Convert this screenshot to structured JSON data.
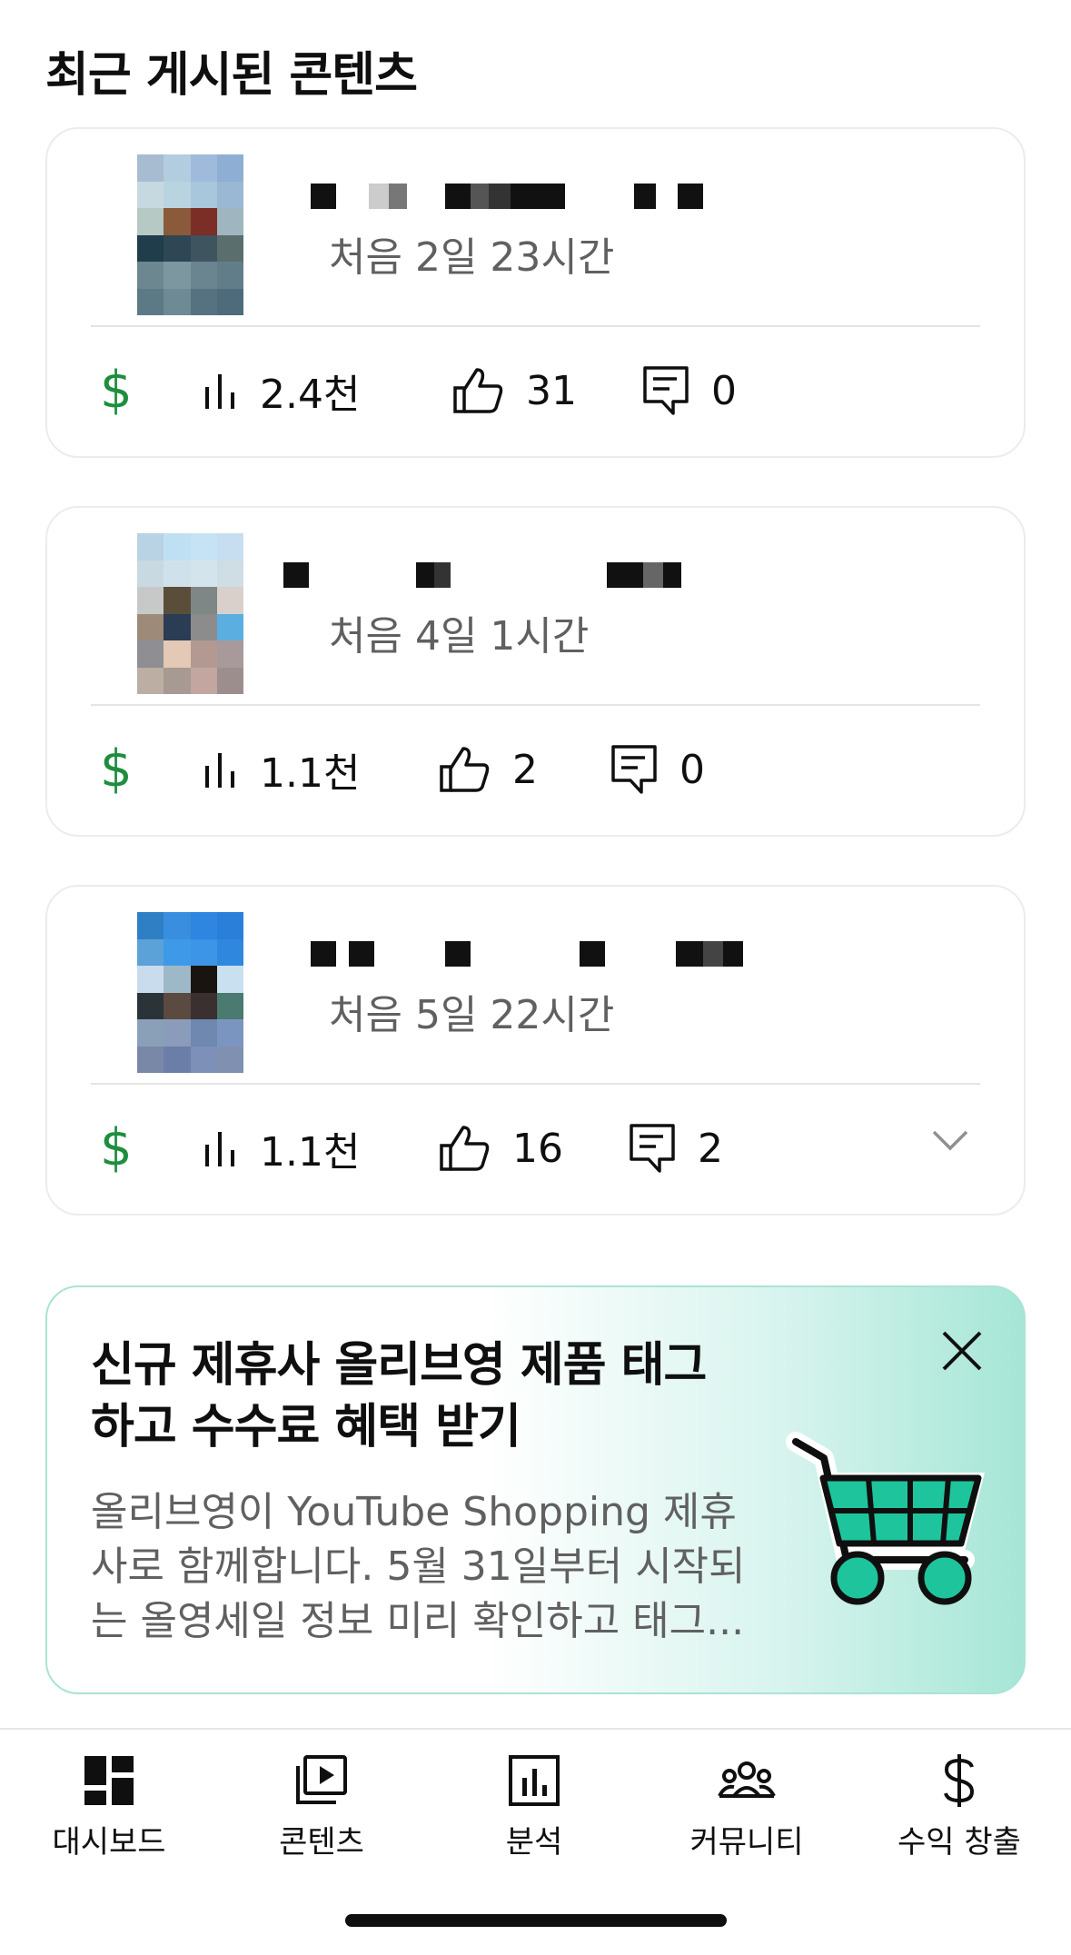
{
  "section": {
    "title": "최근 게시된 콘텐츠"
  },
  "cards": [
    {
      "date": "처음 2일 23시간",
      "views": "2.4천",
      "likes": "31",
      "comments": "0",
      "thumb_colors": [
        "#a7bcd0",
        "#b3cde0",
        "#9fbadb",
        "#8eaed4",
        "#c7d9e0",
        "#b9d4e0",
        "#a8c6dc",
        "#9ab7d4",
        "#b7c9c4",
        "#8a5a3a",
        "#7a2e26",
        "#9fb5bf",
        "#1f3d4a",
        "#2f4655",
        "#3e5560",
        "#5a6e6d",
        "#6d8790",
        "#7d97a0",
        "#6b8590",
        "#627d8a",
        "#5b7a85",
        "#6e8b95",
        "#567280",
        "#4e6b7c"
      ]
    },
    {
      "date": "처음 4일 1시간",
      "views": "1.1천",
      "likes": "2",
      "comments": "0",
      "thumb_colors": [
        "#b9d3e4",
        "#bfe0f2",
        "#c5e3f5",
        "#c6def0",
        "#c9d9e2",
        "#cfe2ec",
        "#d3e4ec",
        "#cfdde4",
        "#c7c9c8",
        "#5a4e3a",
        "#7e8686",
        "#d9d0cc",
        "#9e8a78",
        "#2b3c55",
        "#8c8c8c",
        "#5aaee0",
        "#8e8e93",
        "#e3c9b6",
        "#b29a93",
        "#a89a9a",
        "#bcaea2",
        "#a69a92",
        "#c3a6a0",
        "#9c8e8c"
      ]
    },
    {
      "date": "처음 5일 22시간",
      "views": "1.1천",
      "likes": "16",
      "comments": "2",
      "thumb_colors": [
        "#2f7fc4",
        "#3a8ee0",
        "#2f86e0",
        "#2a7fd8",
        "#5aa2d8",
        "#3e9ae8",
        "#3c95e6",
        "#2f88de",
        "#c9dcee",
        "#9fb8c8",
        "#1a1410",
        "#c8e0ef",
        "#2a3438",
        "#5a4a40",
        "#3a3030",
        "#4a7a70",
        "#8aa0b8",
        "#8a9cba",
        "#6e88b0",
        "#7a96c0",
        "#7a88a8",
        "#6a7ea8",
        "#7c90b8",
        "#8090b0"
      ]
    }
  ],
  "promo": {
    "title": "신규 제휴사 올리브영 제품 태그 하고 수수료 혜택 받기",
    "body": "올리브영이 YouTube Shopping 제휴사로 함께합니다. 5월 31일부터 시작되는 올영세일 정보 미리 확인하고 태그..."
  },
  "nav": {
    "items": [
      {
        "label": "대시보드",
        "icon": "dashboard-icon"
      },
      {
        "label": "콘텐츠",
        "icon": "content-icon"
      },
      {
        "label": "분석",
        "icon": "analytics-icon"
      },
      {
        "label": "커뮤니티",
        "icon": "community-icon"
      },
      {
        "label": "수익 창출",
        "icon": "monetization-icon"
      }
    ],
    "active_color": "#0f0f0f"
  },
  "colors": {
    "monetization_green": "#1e8e3e",
    "secondary_text": "#606060",
    "promo_accent": "#1ec59c"
  }
}
